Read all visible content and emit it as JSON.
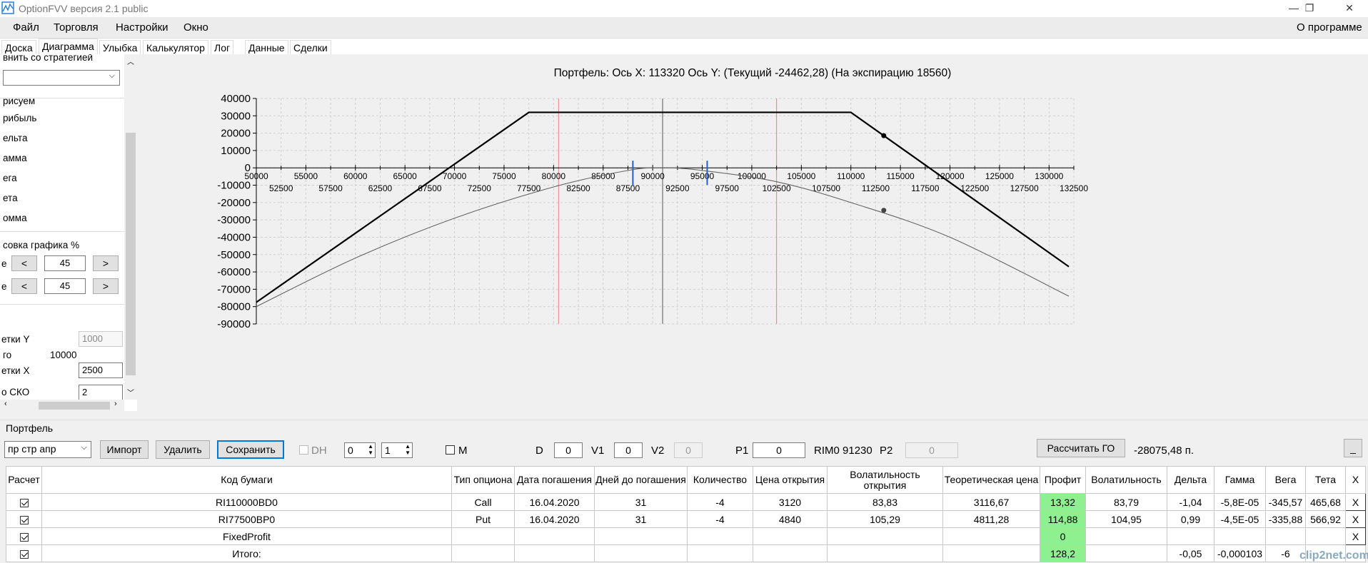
{
  "window": {
    "title": "OptionFVV версия 2.1 public",
    "minimize": "—",
    "maximize": "❐",
    "close": "✕"
  },
  "menu": {
    "items": [
      "Файл",
      "Торговля",
      "Настройки",
      "Окно"
    ],
    "about": "О программе"
  },
  "tabs": [
    "Доска",
    "Диаграмма",
    "Улыбка",
    "Калькулятор",
    "Лог",
    "Данные",
    "Сделки"
  ],
  "left_panel": {
    "compare_label": "внить со стратегией",
    "draw_label": "рисуем",
    "options": [
      "рибыль",
      "ельта",
      "амма",
      "ега",
      "ета",
      "омма"
    ],
    "scale_label": "совка графика %",
    "row1_prefix": "е",
    "row1_value": "45",
    "row1_left": "<",
    "row1_right": ">",
    "row2_prefix": "е",
    "row2_value": "45",
    "row2_left": "<",
    "row2_right": ">",
    "grid_y_label": "етки Y",
    "grid_y_value": "1000",
    "total_label": "го",
    "total_value": "10000",
    "grid_x_label": "етки X",
    "grid_x_value": "2500",
    "sko_label": "о СКО",
    "sko_value": "2"
  },
  "chart_title": "Портфель: Ось X: 113320 Ось Y:  (Текущий -24462,28)  (На экспирацию 18560)",
  "chart_data": {
    "type": "line",
    "title": "Портфель: Ось X: 113320 Ось Y:  (Текущий -24462,28)  (На экспирацию 18560)",
    "xlim": [
      50000,
      132500
    ],
    "ylim": [
      -90000,
      40000
    ],
    "x_ticks_upper": [
      50000,
      55000,
      60000,
      65000,
      70000,
      75000,
      80000,
      85000,
      90000,
      95000,
      100000,
      105000,
      110000,
      115000,
      120000,
      125000,
      130000
    ],
    "x_ticks_lower": [
      52500,
      57500,
      62500,
      67500,
      72500,
      77500,
      82500,
      87500,
      92500,
      97500,
      102500,
      107500,
      112500,
      117500,
      122500,
      127500,
      132500
    ],
    "y_ticks": [
      40000,
      30000,
      20000,
      10000,
      0,
      -10000,
      -20000,
      -30000,
      -40000,
      -50000,
      -60000,
      -70000,
      -80000,
      -90000
    ],
    "series": [
      {
        "color": "#000000",
        "x": [
          50000,
          77500,
          110000,
          132000
        ],
        "y": [
          -77500,
          32000,
          32000,
          -57000
        ]
      },
      {
        "color": "#666666",
        "x": [
          50000,
          60000,
          70000,
          80000,
          87500,
          91000,
          95000,
          102500,
          110000,
          120000,
          132000
        ],
        "y": [
          -80000,
          -52000,
          -29000,
          -11000,
          -1500,
          0,
          -1500,
          -8000,
          -20000,
          -40000,
          -74000
        ]
      }
    ],
    "markers": [
      {
        "x": 113320,
        "y": 18560,
        "color": "#000000"
      },
      {
        "x": 113320,
        "y": -24462,
        "color": "#444444"
      }
    ],
    "vlines": [
      {
        "x": 80500,
        "color": "#f08080"
      },
      {
        "x": 91000,
        "color": "#555555"
      },
      {
        "x": 102500,
        "color": "#f08080"
      }
    ],
    "blue_marks": [
      88000,
      95500
    ],
    "grid": true
  },
  "portfolio_label": "Портфель",
  "toolbar": {
    "strategy_select": "пр стр апр",
    "import": "Импорт",
    "delete": "Удалить",
    "save": "Сохранить",
    "dh_label": "DH",
    "spin1": "0",
    "spin2": "1",
    "m_label": "M",
    "d_label": "D",
    "d_value": "0",
    "v1_label": "V1",
    "v1_value": "0",
    "v2_label": "V2",
    "v2_value": "0",
    "p1_label": "P1",
    "p1_value": "0",
    "rim_text": "RIM0 91230",
    "p2_label": "P2",
    "p2_value": "0",
    "calc_go": "Рассчитать ГО",
    "go_value": "-28075,48 п.",
    "minimize": "_"
  },
  "table": {
    "headers": [
      "Расчет",
      "Код бумаги",
      "Тип опциона",
      "Дата погашения",
      "Дней до погашения",
      "Количество",
      "Цена открытия",
      "Волатильность открытия",
      "Теоретическая цена",
      "Профит",
      "Волатильность",
      "Дельта",
      "Гамма",
      "Вега",
      "Тета",
      "X"
    ],
    "rows": [
      [
        "✓",
        "RI110000BD0",
        "Call",
        "16.04.2020",
        "31",
        "-4",
        "3120",
        "83,83",
        "3116,67",
        "13,32",
        "83,79",
        "-1,04",
        "-5,8E-05",
        "-345,57",
        "465,68",
        "X"
      ],
      [
        "✓",
        "RI77500BP0",
        "Put",
        "16.04.2020",
        "31",
        "-4",
        "4840",
        "105,29",
        "4811,28",
        "114,88",
        "104,95",
        "0,99",
        "-4,5E-05",
        "-335,88",
        "566,92",
        "X"
      ],
      [
        "✓",
        "FixedProfit",
        "",
        "",
        "",
        "",
        "",
        "",
        "",
        "0",
        "",
        "",
        "",
        "",
        "",
        "X"
      ],
      [
        "✓",
        "Итого:",
        "",
        "",
        "",
        "",
        "",
        "",
        "",
        "128,2",
        "",
        "-0,05",
        "-0,000103",
        "-6",
        "",
        ""
      ]
    ]
  },
  "watermark": "clip2net.com"
}
